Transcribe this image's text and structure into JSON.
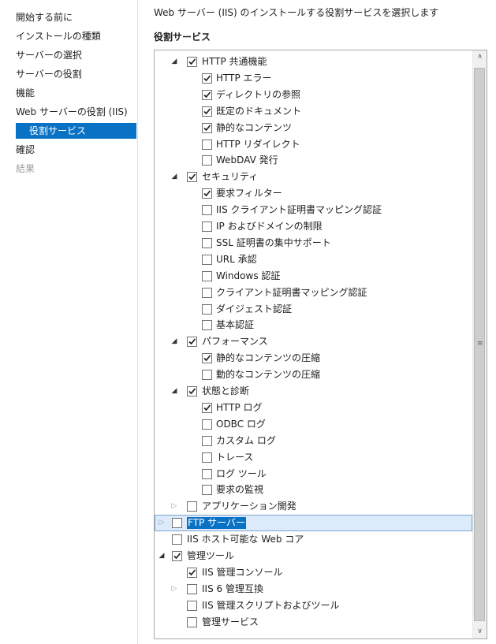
{
  "nav": {
    "items": [
      {
        "label": "開始する前に",
        "state": "normal"
      },
      {
        "label": "インストールの種類",
        "state": "normal"
      },
      {
        "label": "サーバーの選択",
        "state": "normal"
      },
      {
        "label": "サーバーの役割",
        "state": "normal"
      },
      {
        "label": "機能",
        "state": "normal"
      },
      {
        "label": "Web サーバーの役割 (IIS)",
        "state": "normal"
      },
      {
        "label": "役割サービス",
        "state": "active"
      },
      {
        "label": "確認",
        "state": "normal"
      },
      {
        "label": "結果",
        "state": "disabled"
      }
    ]
  },
  "main": {
    "description": "Web サーバー (IIS) のインストールする役割サービスを選択します",
    "section_title": "役割サービス"
  },
  "tree": [
    {
      "label": "HTTP 共通機能",
      "level": 1,
      "checked": true,
      "expander": "expanded"
    },
    {
      "label": "HTTP エラー",
      "level": 2,
      "checked": true
    },
    {
      "label": "ディレクトリの参照",
      "level": 2,
      "checked": true
    },
    {
      "label": "既定のドキュメント",
      "level": 2,
      "checked": true
    },
    {
      "label": "静的なコンテンツ",
      "level": 2,
      "checked": true
    },
    {
      "label": "HTTP リダイレクト",
      "level": 2,
      "checked": false
    },
    {
      "label": "WebDAV 発行",
      "level": 2,
      "checked": false
    },
    {
      "label": "セキュリティ",
      "level": 1,
      "checked": true,
      "expander": "expanded"
    },
    {
      "label": "要求フィルター",
      "level": 2,
      "checked": true
    },
    {
      "label": "IIS クライアント証明書マッピング認証",
      "level": 2,
      "checked": false
    },
    {
      "label": "IP およびドメインの制限",
      "level": 2,
      "checked": false
    },
    {
      "label": "SSL 証明書の集中サポート",
      "level": 2,
      "checked": false
    },
    {
      "label": "URL 承認",
      "level": 2,
      "checked": false
    },
    {
      "label": "Windows 認証",
      "level": 2,
      "checked": false
    },
    {
      "label": "クライアント証明書マッピング認証",
      "level": 2,
      "checked": false
    },
    {
      "label": "ダイジェスト認証",
      "level": 2,
      "checked": false
    },
    {
      "label": "基本認証",
      "level": 2,
      "checked": false
    },
    {
      "label": "パフォーマンス",
      "level": 1,
      "checked": true,
      "expander": "expanded"
    },
    {
      "label": "静的なコンテンツの圧縮",
      "level": 2,
      "checked": true
    },
    {
      "label": "動的なコンテンツの圧縮",
      "level": 2,
      "checked": false
    },
    {
      "label": "状態と診断",
      "level": 1,
      "checked": true,
      "expander": "expanded"
    },
    {
      "label": "HTTP ログ",
      "level": 2,
      "checked": true
    },
    {
      "label": "ODBC ログ",
      "level": 2,
      "checked": false
    },
    {
      "label": "カスタム ログ",
      "level": 2,
      "checked": false
    },
    {
      "label": "トレース",
      "level": 2,
      "checked": false
    },
    {
      "label": "ログ ツール",
      "level": 2,
      "checked": false
    },
    {
      "label": "要求の監視",
      "level": 2,
      "checked": false
    },
    {
      "label": "アプリケーション開発",
      "level": 1,
      "checked": false,
      "expander": "collapsed"
    },
    {
      "label": "FTP サーバー",
      "level": 0,
      "checked": false,
      "expander": "collapsed",
      "selected": true
    },
    {
      "label": "IIS ホスト可能な Web コア",
      "level": 0,
      "checked": false
    },
    {
      "label": "管理ツール",
      "level": 0,
      "checked": true,
      "expander": "expanded"
    },
    {
      "label": "IIS 管理コンソール",
      "level": 1,
      "checked": true
    },
    {
      "label": "IIS 6 管理互換",
      "level": 1,
      "checked": false,
      "expander": "collapsed"
    },
    {
      "label": "IIS 管理スクリプトおよびツール",
      "level": 1,
      "checked": false
    },
    {
      "label": "管理サービス",
      "level": 1,
      "checked": false
    }
  ],
  "scrollbar": {
    "up_icon": "scroll-up-arrow",
    "down_icon": "scroll-down-arrow",
    "grip_icon": "grip-lines"
  }
}
